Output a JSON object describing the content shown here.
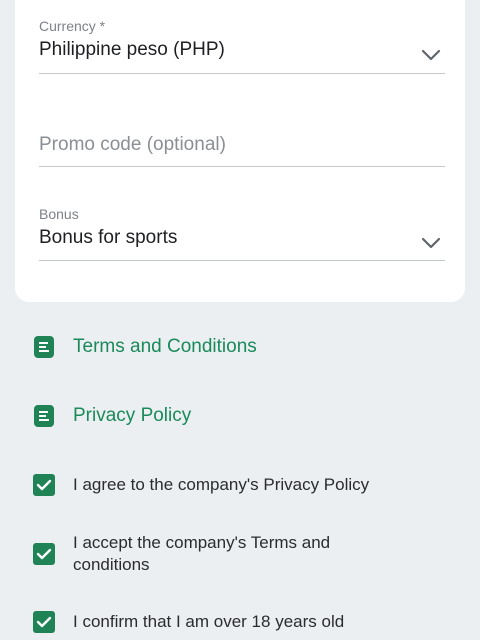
{
  "form": {
    "currency": {
      "label": "Currency *",
      "value": "Philippine peso (PHP)"
    },
    "promo": {
      "placeholder": "Promo code (optional)"
    },
    "bonus": {
      "label": "Bonus",
      "value": "Bonus for sports"
    }
  },
  "links": {
    "terms": "Terms and Conditions",
    "privacy": "Privacy Policy"
  },
  "agreements": [
    {
      "text": "I agree to the company's Privacy Policy",
      "checked": true
    },
    {
      "text": "I accept the company's Terms and conditions",
      "checked": true
    },
    {
      "text": "I confirm that I am over 18 years old",
      "checked": true
    }
  ],
  "colors": {
    "accent": "#1a8a5a",
    "checkbox": "#1f8355",
    "background": "#eceff2"
  }
}
